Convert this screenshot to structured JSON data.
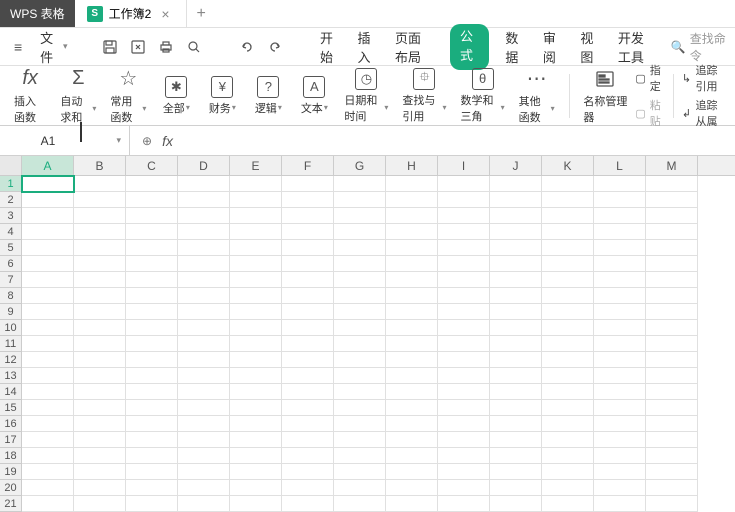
{
  "app_name": "WPS 表格",
  "tab": {
    "title": "工作簿2",
    "icon_letter": "S"
  },
  "file_menu_label": "文件",
  "menu_tabs": [
    "开始",
    "插入",
    "页面布局",
    "公式",
    "数据",
    "审阅",
    "视图",
    "开发工具"
  ],
  "active_menu_tab": "公式",
  "search_placeholder": "查找命令",
  "ribbon": {
    "insert_fn": "插入函数",
    "auto_sum": "自动求和",
    "common_fn": "常用函数",
    "all": "全部",
    "financial": "财务",
    "logical": "逻辑",
    "text": "文本",
    "date_time": "日期和时间",
    "lookup": "查找与引用",
    "math_trig": "数学和三角",
    "other_fn": "其他函数",
    "name_mgr": "名称管理器",
    "define_name": "指定",
    "paste": "粘贴",
    "trace_prec": "追踪引用",
    "trace_dep": "追踪从属"
  },
  "name_box_value": "A1",
  "formula_value": "",
  "columns": [
    "A",
    "B",
    "C",
    "D",
    "E",
    "F",
    "G",
    "H",
    "I",
    "J",
    "K",
    "L",
    "M"
  ],
  "rows": [
    1,
    2,
    3,
    4,
    5,
    6,
    7,
    8,
    9,
    10,
    11,
    12,
    13,
    14,
    15,
    16,
    17,
    18,
    19,
    20,
    21
  ],
  "selected_cell": "A1",
  "colors": {
    "accent": "#1aad7e"
  }
}
